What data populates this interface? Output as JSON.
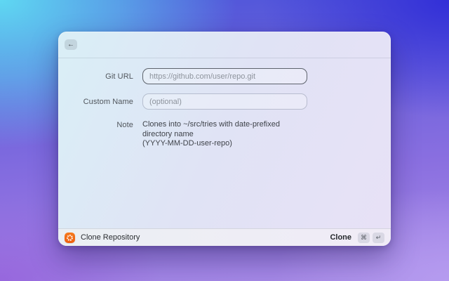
{
  "window": {
    "header": {
      "back_icon": "←"
    },
    "form": {
      "fields": [
        {
          "label": "Git URL",
          "value": "",
          "placeholder": "https://github.com/user/repo.git",
          "state": "focused"
        },
        {
          "label": "Custom Name",
          "value": "",
          "placeholder": "(optional)",
          "state": "unfocused"
        }
      ],
      "note": {
        "label": "Note",
        "lines": [
          "Clones into ~/src/tries with date-prefixed directory name",
          "(YYYY-MM-DD-user-repo)"
        ]
      }
    },
    "footer": {
      "app_name": "Clone Repository",
      "primary_action": "Clone",
      "shortcut_keys": [
        "⌘",
        "↵"
      ]
    }
  },
  "colors": {
    "accent_orange": "#F06A15",
    "bg_top_left": "#5FD8F2",
    "bg_top_right": "#302DD7",
    "bg_bottom_left": "#9664DC",
    "bg_bottom_right": "#B69CF0"
  }
}
